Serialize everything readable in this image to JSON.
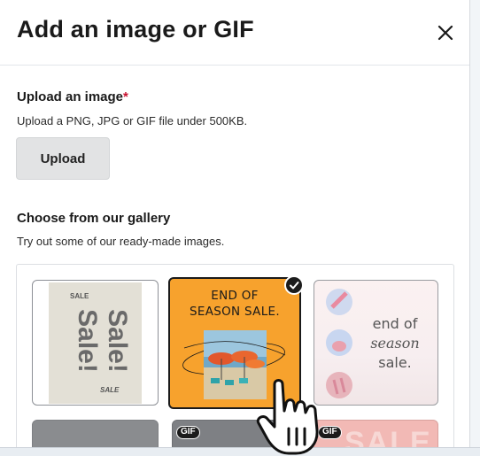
{
  "modal": {
    "title": "Add an image or GIF"
  },
  "upload": {
    "title": "Upload an image",
    "required_mark": "*",
    "description": "Upload a PNG, JPG or GIF file under 500KB.",
    "button_label": "Upload"
  },
  "gallery": {
    "title": "Choose from our gallery",
    "description": "Try out some of our ready-made images.",
    "selected_index": 1,
    "tiles": [
      {
        "kind": "image",
        "small_top": "SALE",
        "big_1": "Sale!",
        "big_2": "Sale!",
        "small_bottom": "SALE"
      },
      {
        "kind": "image",
        "text_1": "END OF",
        "text_2": "SEASON SALE.",
        "selected": true
      },
      {
        "kind": "image",
        "text_1": "end of",
        "text_2": "season",
        "text_3": "sale."
      },
      {
        "kind": "image"
      },
      {
        "kind": "gif",
        "badge": "GIF"
      },
      {
        "kind": "gif",
        "badge": "GIF",
        "text_1": "SALE"
      }
    ]
  },
  "icons": {
    "close": "close-icon",
    "check": "check-icon",
    "cursor": "hand-pointer-icon"
  },
  "colors": {
    "required": "#c8102e",
    "selected_tile_bg": "#f7a22d",
    "upload_button_bg": "#e2e3e4"
  }
}
